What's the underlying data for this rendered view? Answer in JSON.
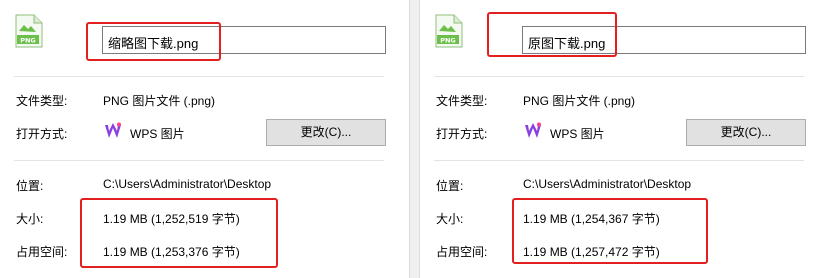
{
  "left": {
    "filename": "缩略图下载.png",
    "type_label": "文件类型:",
    "type_value": "PNG 图片文件 (.png)",
    "open_label": "打开方式:",
    "open_app": "WPS 图片",
    "change_button": "更改(C)...",
    "location_label": "位置:",
    "location_value": "C:\\Users\\Administrator\\Desktop",
    "size_label": "大小:",
    "size_value": "1.19 MB (1,252,519 字节)",
    "disk_label": "占用空间:",
    "disk_value": "1.19 MB (1,253,376 字节)"
  },
  "right": {
    "filename": "原图下载.png",
    "type_label": "文件类型:",
    "type_value": "PNG 图片文件 (.png)",
    "open_label": "打开方式:",
    "open_app": "WPS 图片",
    "change_button": "更改(C)...",
    "location_label": "位置:",
    "location_value": "C:\\Users\\Administrator\\Desktop",
    "size_label": "大小:",
    "size_value": "1.19 MB (1,254,367 字节)",
    "disk_label": "占用空间:",
    "disk_value": "1.19 MB (1,257,472 字节)"
  },
  "icons": {
    "file": "png-file-icon",
    "app": "wps-picture-icon"
  },
  "colors": {
    "highlight": "#e32020",
    "icon_green": "#6cbf4a",
    "button_bg": "#e1e1e1"
  }
}
